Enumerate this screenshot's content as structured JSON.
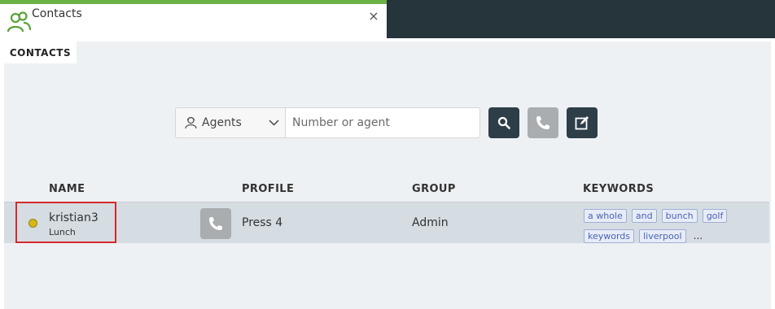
{
  "window": {
    "title": "Contacts",
    "close_glyph": "×"
  },
  "section_tab": {
    "label": "CONTACTS"
  },
  "search": {
    "filter_label": "Agents",
    "placeholder": "Number or agent"
  },
  "columns": {
    "name": "NAME",
    "profile": "PROFILE",
    "group": "GROUP",
    "keywords": "KEYWORDS"
  },
  "contacts": [
    {
      "name": "kristian3",
      "status": "Lunch",
      "status_color": "#d6b716",
      "profile": "Press 4",
      "group": "Admin",
      "keywords": [
        "a whole",
        "and",
        "bunch",
        "golf",
        "keywords",
        "liverpool"
      ],
      "more": "..."
    }
  ],
  "colors": {
    "accent_green": "#6bb345",
    "dark_header": "#26343c",
    "button_dark": "#2d3e48",
    "button_disabled": "#a9adb0",
    "selection_outline": "#d42a2a"
  }
}
